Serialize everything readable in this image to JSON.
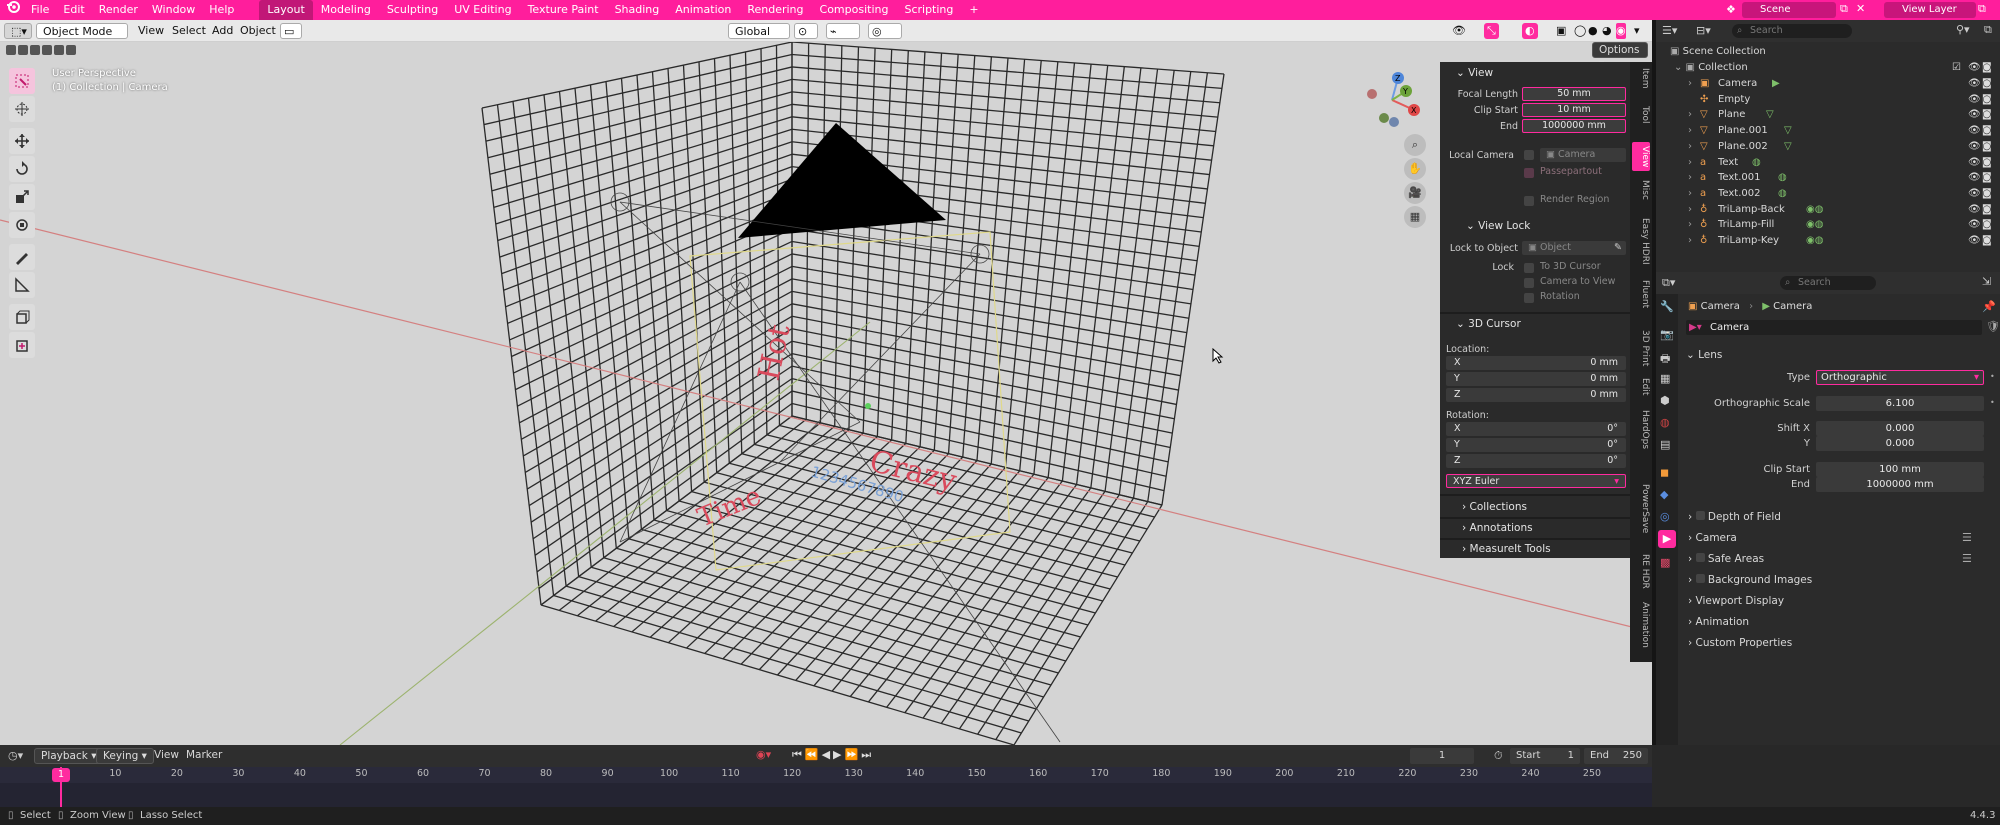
{
  "menu": [
    "File",
    "Edit",
    "Render",
    "Window",
    "Help"
  ],
  "workspaces": [
    "Layout",
    "Modeling",
    "Sculpting",
    "UV Editing",
    "Texture Paint",
    "Shading",
    "Animation",
    "Rendering",
    "Compositing",
    "Scripting"
  ],
  "active_workspace": "Layout",
  "scene_name": "Scene",
  "view_layer_name": "View Layer",
  "viewport_header": {
    "mode": "Object Mode",
    "menus": [
      "View",
      "Select",
      "Add",
      "Object"
    ],
    "transform_orientation": "Global",
    "options_label": "Options"
  },
  "viewport": {
    "perspective_label": "User Perspective",
    "collection_label": "(1) Collection | Camera",
    "scene_texts": [
      "Hot",
      "Crazy",
      "Time",
      "1234567890"
    ]
  },
  "npanel": {
    "view_header": "View",
    "focal_length_label": "Focal Length",
    "focal_length": "50 mm",
    "clip_start_label": "Clip Start",
    "clip_start": "10 mm",
    "end_label": "End",
    "end": "1000000 mm",
    "local_camera_label": "Local Camera",
    "local_camera": "Camera",
    "passepartout": "Passepartout",
    "render_region": "Render Region",
    "view_lock_header": "View Lock",
    "lock_to_object_label": "Lock to Object",
    "lock_to_object_placeholder": "Object",
    "lock_label": "Lock",
    "lock_options": [
      "To 3D Cursor",
      "Camera to View",
      "Rotation"
    ],
    "cursor_header": "3D Cursor",
    "location_label": "Location:",
    "location": [
      {
        "axis": "X",
        "value": "0 mm"
      },
      {
        "axis": "Y",
        "value": "0 mm"
      },
      {
        "axis": "Z",
        "value": "0 mm"
      }
    ],
    "rotation_label": "Rotation:",
    "rotation": [
      {
        "axis": "X",
        "value": "0°"
      },
      {
        "axis": "Y",
        "value": "0°"
      },
      {
        "axis": "Z",
        "value": "0°"
      }
    ],
    "rotation_mode": "XYZ Euler",
    "collapsed": [
      "Collections",
      "Annotations",
      "MeasureIt Tools"
    ]
  },
  "npanel_tabs": [
    "Item",
    "Tool",
    "View",
    "Misc",
    "Easy HDRI",
    "Fluent",
    "3D Print",
    "Edit",
    "HardOps",
    "PowerSave",
    "RE HDR",
    "Animation"
  ],
  "outliner": {
    "search_placeholder": "Search",
    "scene_collection": "Scene Collection",
    "collection": "Collection",
    "items": [
      "Camera",
      "Empty",
      "Plane",
      "Plane.001",
      "Plane.002",
      "Text",
      "Text.001",
      "Text.002",
      "TriLamp-Back",
      "TriLamp-Fill",
      "TriLamp-Key"
    ]
  },
  "properties": {
    "search_placeholder": "Search",
    "breadcrumb": [
      "Camera",
      "Camera"
    ],
    "datablock_name": "Camera",
    "lens_header": "Lens",
    "type_label": "Type",
    "type_value": "Orthographic",
    "ortho_scale_label": "Orthographic Scale",
    "ortho_scale": "6.100",
    "shift_x_label": "Shift X",
    "shift_x": "0.000",
    "shift_y_label": "Y",
    "shift_y": "0.000",
    "clip_start_label": "Clip Start",
    "clip_start": "100 mm",
    "clip_end_label": "End",
    "clip_end": "1000000 mm",
    "sections": [
      "Depth of Field",
      "Camera",
      "Safe Areas",
      "Background Images",
      "Viewport Display",
      "Animation",
      "Custom Properties"
    ]
  },
  "timeline": {
    "menus": [
      "Playback",
      "Keying",
      "View",
      "Marker"
    ],
    "current_frame": "1",
    "start_label": "Start",
    "start": "1",
    "end_label": "End",
    "end": "250",
    "ticks": [
      "1",
      "10",
      "20",
      "30",
      "40",
      "50",
      "60",
      "70",
      "80",
      "90",
      "100",
      "110",
      "120",
      "130",
      "140",
      "150",
      "160",
      "170",
      "180",
      "190",
      "200",
      "210",
      "220",
      "230",
      "240",
      "250"
    ]
  },
  "statusbar": {
    "hints": [
      "Select",
      "Zoom View",
      "Lasso Select"
    ],
    "version": "4.4.3"
  },
  "colors": {
    "accent": "#ff1e9c",
    "panel": "#2b2b2b",
    "viewport": "#d4d4d4"
  }
}
